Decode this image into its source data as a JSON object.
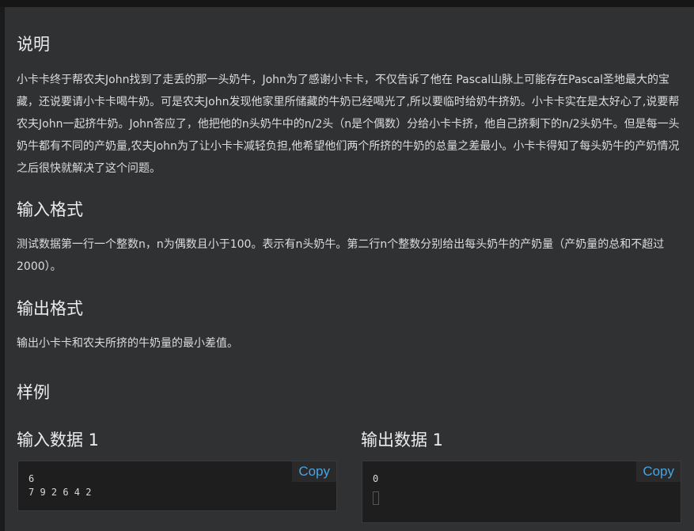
{
  "description": {
    "title": "说明",
    "text": "小卡卡终于帮农夫John找到了走丢的那一头奶牛，John为了感谢小卡卡，不仅告诉了他在 Pascal山脉上可能存在Pascal圣地最大的宝藏，还说要请小卡卡喝牛奶。可是农夫John发现他家里所储藏的牛奶已经喝光了,所以要临时给奶牛挤奶。小卡卡实在是太好心了,说要帮农夫John一起挤牛奶。John答应了，他把他的n头奶牛中的n/2头（n是个偶数）分给小卡卡挤，他自己挤剩下的n/2头奶牛。但是每一头奶牛都有不同的产奶量,农夫John为了让小卡卡减轻负担,他希望他们两个所挤的牛奶的总量之差最小。小卡卡得知了每头奶牛的产奶情况之后很快就解决了这个问题。"
  },
  "input_format": {
    "title": "输入格式",
    "text": "测试数据第一行一个整数n，n为偶数且小于100。表示有n头奶牛。第二行n个整数分别给出每头奶牛的产奶量（产奶量的总和不超过2000）。"
  },
  "output_format": {
    "title": "输出格式",
    "text": "输出小卡卡和农夫所挤的牛奶量的最小差值。"
  },
  "samples": {
    "title": "样例",
    "input_title": "输入数据 1",
    "input_code": "6\n7 9 2 6 4 2",
    "output_title": "输出数据 1",
    "output_code": "0",
    "copy_label": "Copy"
  },
  "colors": {
    "background": "#303133",
    "copy_accent": "#4aa3df"
  }
}
